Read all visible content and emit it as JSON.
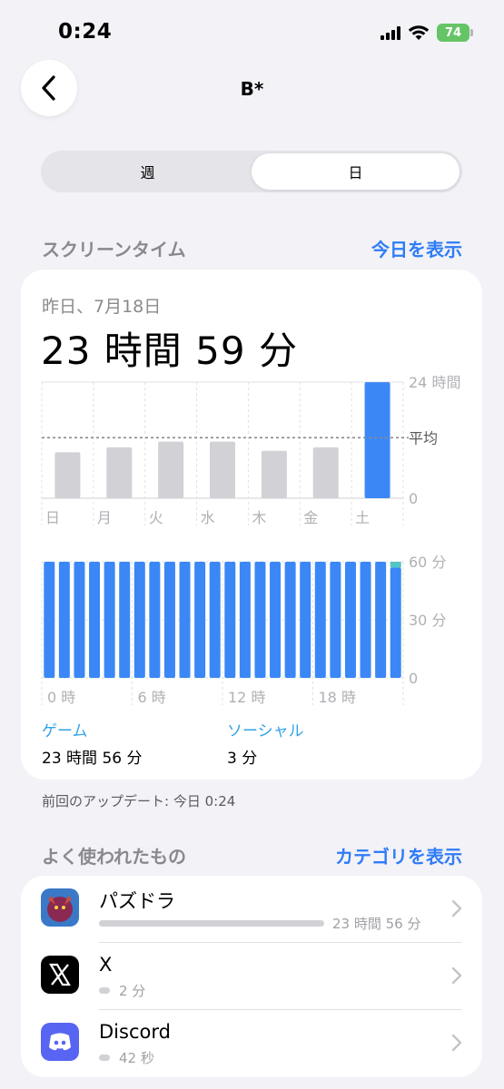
{
  "status": {
    "time": "0:24",
    "battery": "74"
  },
  "nav": {
    "title": "B*"
  },
  "segments": [
    "週",
    "日"
  ],
  "screen_time": {
    "header": "スクリーンタイム",
    "link": "今日を表示",
    "date": "昨日、7月18日",
    "total": "23 時間 59 分"
  },
  "chart_data": [
    {
      "type": "bar",
      "categories": [
        "日",
        "月",
        "火",
        "水",
        "木",
        "金",
        "土"
      ],
      "values": [
        9.5,
        10.5,
        11.7,
        11.7,
        9.8,
        10.5,
        23.98
      ],
      "highlight_index": 6,
      "average": 12.5,
      "y_tick_labels": [
        "24 時間",
        "平均",
        "0"
      ],
      "ylim": [
        0,
        24
      ],
      "colors": {
        "bar": "#d1d1d6",
        "highlight": "#3b87f5"
      }
    },
    {
      "type": "bar",
      "categories": [
        "0",
        "1",
        "2",
        "3",
        "4",
        "5",
        "6",
        "7",
        "8",
        "9",
        "10",
        "11",
        "12",
        "13",
        "14",
        "15",
        "16",
        "17",
        "18",
        "19",
        "20",
        "21",
        "22",
        "23"
      ],
      "values": [
        60,
        60,
        60,
        60,
        60,
        60,
        60,
        60,
        60,
        60,
        60,
        60,
        60,
        60,
        60,
        60,
        60,
        60,
        60,
        60,
        60,
        60,
        60,
        60
      ],
      "secondary_values": [
        0,
        0,
        0,
        0,
        0,
        0,
        0,
        0,
        0,
        0,
        0,
        0,
        0,
        0,
        0,
        0,
        0,
        0,
        0,
        0,
        0,
        0,
        0,
        3
      ],
      "x_tick_labels": [
        "0 時",
        "6 時",
        "12 時",
        "18 時"
      ],
      "y_tick_labels": [
        "60 分",
        "30 分",
        "0"
      ],
      "ylim": [
        0,
        60
      ],
      "colors": {
        "bar": "#3b87f5",
        "secondary": "#52c7c4"
      }
    }
  ],
  "categories": [
    {
      "label": "ゲーム",
      "value": "23 時間 56 分"
    },
    {
      "label": "ソーシャル",
      "value": "3 分"
    }
  ],
  "footnote": "前回のアップデート: 今日 0:24",
  "most_used": {
    "header": "よく使われたもの",
    "link": "カテゴリを表示",
    "apps": [
      {
        "name": "パズドラ",
        "time": "23 時間 56 分",
        "fraction": 1.0
      },
      {
        "name": "X",
        "time": "2 分",
        "fraction": 0.0
      },
      {
        "name": "Discord",
        "time": "42 秒",
        "fraction": 0.0
      }
    ]
  }
}
